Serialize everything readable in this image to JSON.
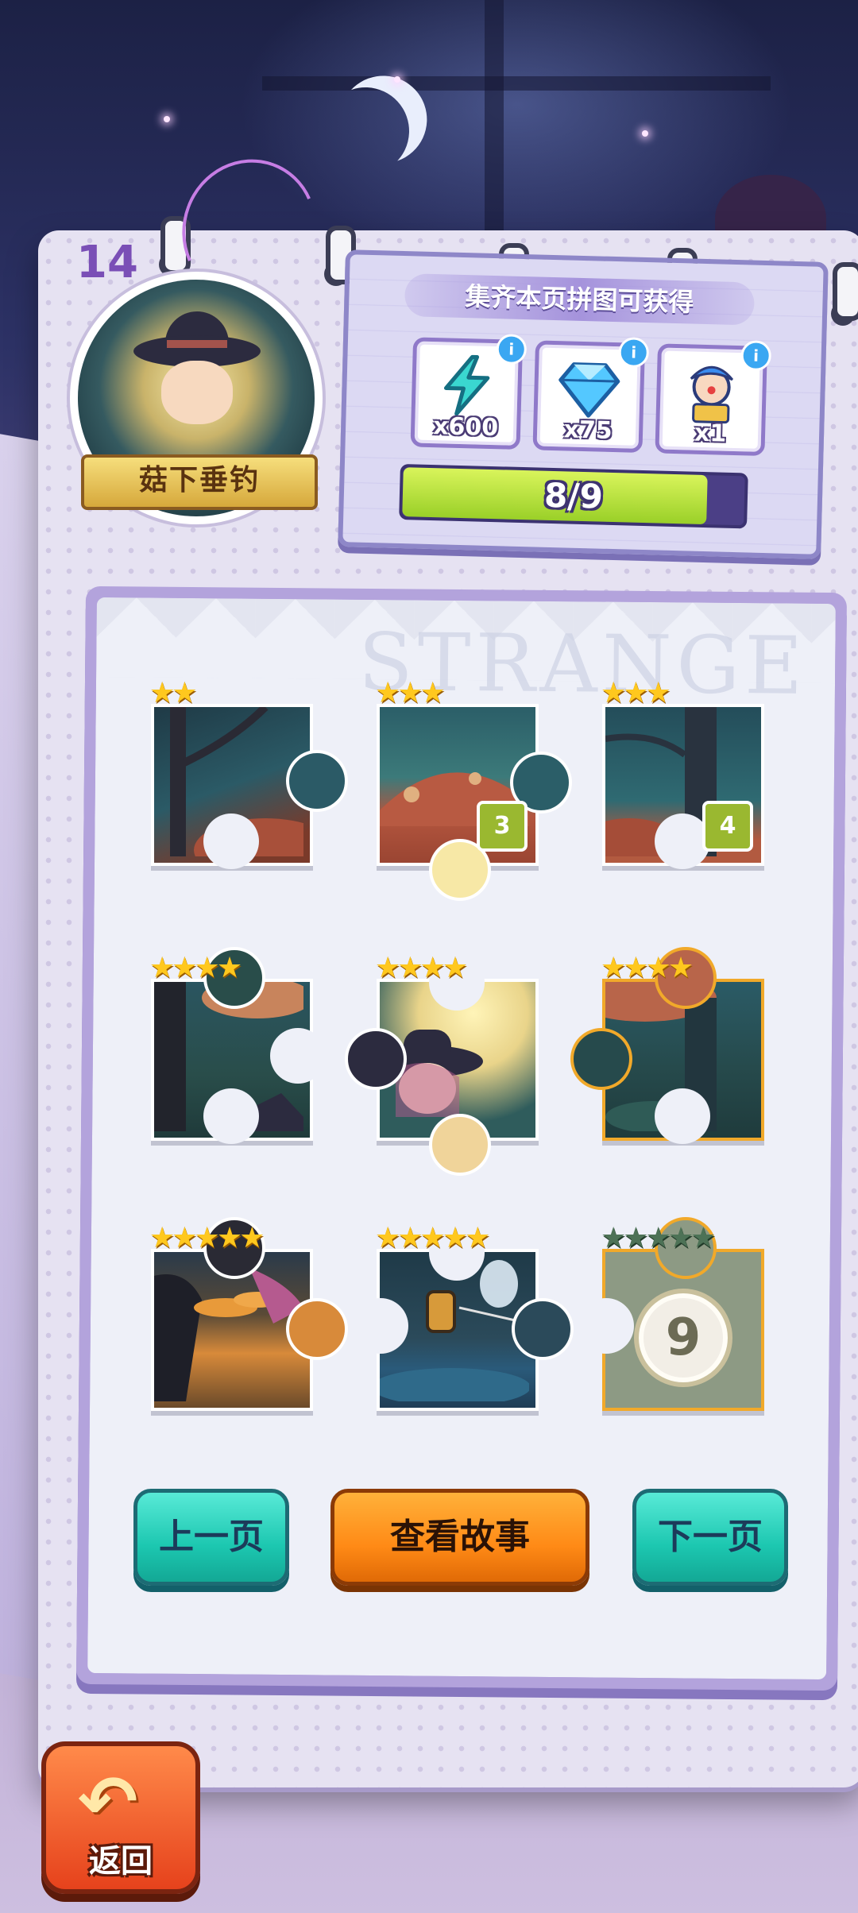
{
  "page": {
    "number": "14",
    "watermark": "STRANGE"
  },
  "badge": {
    "title": "菇下垂钓"
  },
  "reward": {
    "title": "集齐本页拼图可获得",
    "items": [
      {
        "icon": "lightning-energy-icon",
        "qty": "x600",
        "info": "i"
      },
      {
        "icon": "blue-diamond-icon",
        "qty": "x75",
        "info": "i"
      },
      {
        "icon": "clown-character-icon",
        "qty": "x1",
        "info": "i"
      }
    ],
    "progress_text": "8/9",
    "progress_value": 0.889
  },
  "pieces": [
    {
      "stars": "★★",
      "badge": "",
      "locked": false
    },
    {
      "stars": "★★★",
      "badge": "3",
      "locked": false
    },
    {
      "stars": "★★★",
      "badge": "4",
      "locked": false
    },
    {
      "stars": "★★★★",
      "badge": "",
      "locked": false
    },
    {
      "stars": "★★★★",
      "badge": "",
      "locked": false
    },
    {
      "stars": "★★★★",
      "badge": "",
      "locked": false
    },
    {
      "stars": "★★★★★",
      "badge": "",
      "locked": false
    },
    {
      "stars": "★★★★★",
      "badge": "",
      "locked": false
    },
    {
      "stars": "★★★★★",
      "badge": "9",
      "locked": true
    }
  ],
  "buttons": {
    "prev": "上一页",
    "story": "查看故事",
    "next": "下一页",
    "back": "返回"
  },
  "colors": {
    "teal": "#1cc7b0",
    "orange": "#ff8a16",
    "progress": "#9ad028"
  }
}
